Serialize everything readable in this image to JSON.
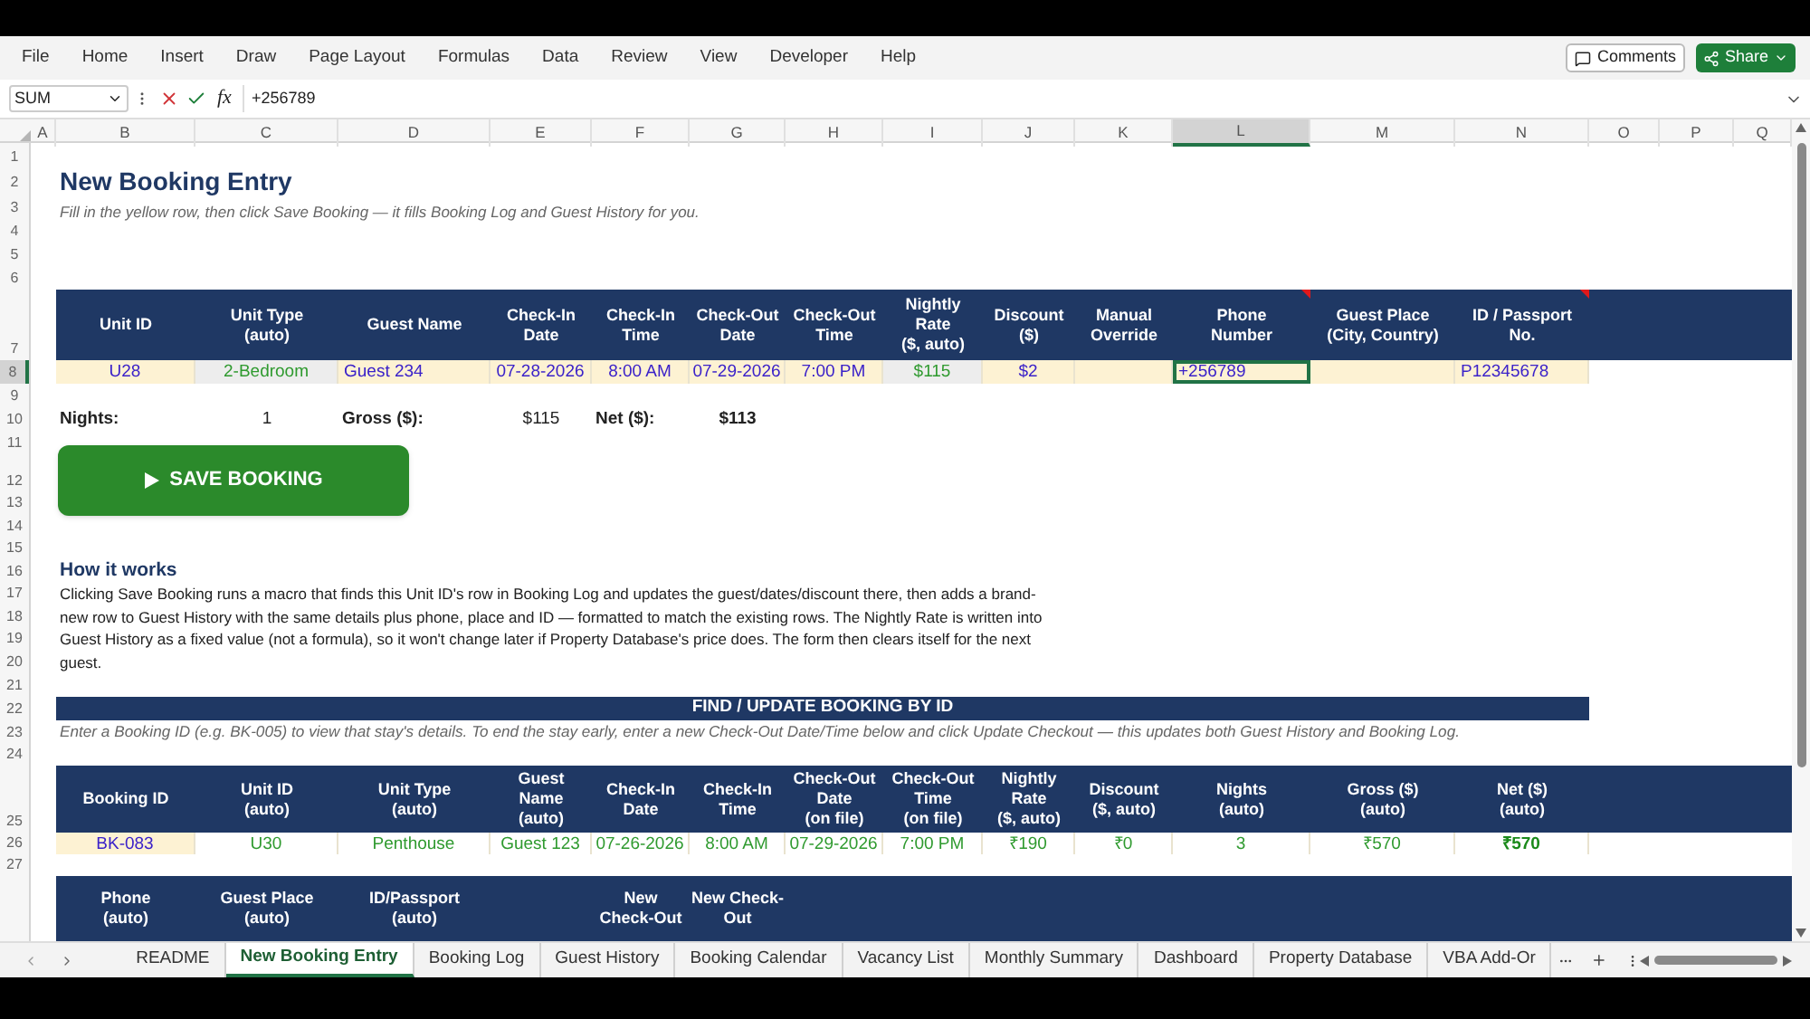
{
  "menu": [
    "File",
    "Home",
    "Insert",
    "Draw",
    "Page Layout",
    "Formulas",
    "Data",
    "Review",
    "View",
    "Developer",
    "Help"
  ],
  "title_bar_buttons": {
    "comments": "Comments",
    "share": "Share"
  },
  "formula_bar": {
    "name_box": "SUM",
    "fx": "fx",
    "value": "+256789"
  },
  "columns": [
    {
      "label": "A",
      "selected": false
    },
    {
      "label": "B",
      "selected": false
    },
    {
      "label": "C",
      "selected": false
    },
    {
      "label": "D",
      "selected": false
    },
    {
      "label": "E",
      "selected": false
    },
    {
      "label": "F",
      "selected": false
    },
    {
      "label": "G",
      "selected": false
    },
    {
      "label": "H",
      "selected": false
    },
    {
      "label": "I",
      "selected": false
    },
    {
      "label": "J",
      "selected": false
    },
    {
      "label": "K",
      "selected": false
    },
    {
      "label": "L",
      "selected": true
    },
    {
      "label": "M",
      "selected": false
    },
    {
      "label": "N",
      "selected": false
    },
    {
      "label": "O",
      "selected": false
    },
    {
      "label": "P",
      "selected": false
    },
    {
      "label": "Q",
      "selected": false
    }
  ],
  "rows": [
    {
      "label": "1",
      "selected": false
    },
    {
      "label": "2",
      "selected": false
    },
    {
      "label": "3",
      "selected": false
    },
    {
      "label": "4",
      "selected": false
    },
    {
      "label": "5",
      "selected": false
    },
    {
      "label": "6",
      "selected": false
    },
    {
      "label": "7",
      "selected": false
    },
    {
      "label": "8",
      "selected": true
    },
    {
      "label": "9",
      "selected": false
    },
    {
      "label": "10",
      "selected": false
    },
    {
      "label": "11",
      "selected": false
    },
    {
      "label": "12",
      "selected": false
    },
    {
      "label": "13",
      "selected": false
    },
    {
      "label": "14",
      "selected": false
    },
    {
      "label": "15",
      "selected": false
    },
    {
      "label": "16",
      "selected": false
    },
    {
      "label": "17",
      "selected": false
    },
    {
      "label": "18",
      "selected": false
    },
    {
      "label": "19",
      "selected": false
    },
    {
      "label": "20",
      "selected": false
    },
    {
      "label": "21",
      "selected": false
    },
    {
      "label": "22",
      "selected": false
    },
    {
      "label": "23",
      "selected": false
    },
    {
      "label": "24",
      "selected": false
    },
    {
      "label": "25",
      "selected": false
    },
    {
      "label": "26",
      "selected": false
    },
    {
      "label": "27",
      "selected": false
    }
  ],
  "sheet": {
    "title": "New Booking Entry",
    "subtitle": "Fill in the yellow row, then click Save Booking — it fills Booking Log and Guest History for you.",
    "entry_table": {
      "columns": [
        {
          "label": "Unit ID",
          "comment": false
        },
        {
          "label": "Unit Type\n(auto)",
          "comment": false
        },
        {
          "label": "Guest Name",
          "comment": false
        },
        {
          "label": "Check-In\nDate",
          "comment": false
        },
        {
          "label": "Check-In\nTime",
          "comment": false
        },
        {
          "label": "Check-Out\nDate",
          "comment": false
        },
        {
          "label": "Check-Out\nTime",
          "comment": false
        },
        {
          "label": "Nightly\nRate\n($, auto)",
          "comment": false
        },
        {
          "label": "Discount\n($)",
          "comment": false
        },
        {
          "label": "Manual\nOverride",
          "comment": false
        },
        {
          "label": "Phone\nNumber",
          "comment": true
        },
        {
          "label": "Guest Place\n(City, Country)",
          "comment": false
        },
        {
          "label": "ID / Passport\nNo.",
          "comment": true
        }
      ],
      "cells": [
        {
          "text": "U28",
          "kind": "input",
          "selected": false
        },
        {
          "text": "2-Bedroom",
          "kind": "auto",
          "selected": false
        },
        {
          "text": "Guest 234",
          "kind": "text",
          "selected": false
        },
        {
          "text": "07-28-2026",
          "kind": "input",
          "selected": false
        },
        {
          "text": "8:00 AM",
          "kind": "input",
          "selected": false
        },
        {
          "text": "07-29-2026",
          "kind": "input",
          "selected": false
        },
        {
          "text": "7:00 PM",
          "kind": "input",
          "selected": false
        },
        {
          "text": "$115",
          "kind": "auto",
          "selected": false
        },
        {
          "text": "$2",
          "kind": "input",
          "selected": false
        },
        {
          "kind": "input",
          "selected": false
        },
        {
          "text": "+256789",
          "kind": "text",
          "selected": true
        },
        {
          "kind": "input",
          "selected": false
        },
        {
          "text": "P12345678",
          "kind": "text",
          "selected": false
        }
      ]
    },
    "summary": [
      {
        "text": "Nights:",
        "kind": "label"
      },
      {
        "text": "1",
        "kind": "value"
      },
      {
        "text": "Gross ($):",
        "kind": "label"
      },
      {
        "text": "$115",
        "kind": "value"
      },
      {
        "text": "Net ($):",
        "kind": "label"
      },
      {
        "text": "$113",
        "kind": "total"
      }
    ],
    "save_button": {
      "label": "SAVE BOOKING"
    },
    "how_it_works": {
      "heading": "How it works",
      "text": "Clicking Save Booking runs a macro that finds this Unit ID's row in Booking Log and updates the guest/dates/discount there, then adds a brand-new row to Guest History with the same details plus phone, place and ID — formatted to match the existing rows. The Nightly Rate is written into Guest History as a fixed value (not a formula), so it won't change later if Property Database's price does. The form then clears itself for the next guest."
    },
    "find_banner": "FIND / UPDATE BOOKING BY ID",
    "find_note": "Enter a Booking ID (e.g. BK-005) to view that stay's details. To end the stay early, enter a new Check-Out Date/Time below and click Update Checkout — this updates both Guest History and Booking Log.",
    "lookup_table": {
      "columns": [
        {
          "label": "Booking ID"
        },
        {
          "label": "Unit ID\n(auto)"
        },
        {
          "label": "Unit Type\n(auto)"
        },
        {
          "label": "Guest\nName\n(auto)"
        },
        {
          "label": "Check-In\nDate"
        },
        {
          "label": "Check-In\nTime"
        },
        {
          "label": "Check-Out\nDate\n(on file)"
        },
        {
          "label": "Check-Out\nTime\n(on file)"
        },
        {
          "label": "Nightly\nRate\n($, auto)"
        },
        {
          "label": "Discount\n($, auto)"
        },
        {
          "label": "Nights\n(auto)"
        },
        {
          "label": "Gross ($)\n(auto)"
        },
        {
          "label": "Net ($)\n(auto)"
        }
      ],
      "cells": [
        {
          "text": "BK-083",
          "kind": "input"
        },
        {
          "text": "U30",
          "kind": "result"
        },
        {
          "text": "Penthouse",
          "kind": "result"
        },
        {
          "text": "Guest 123",
          "kind": "result"
        },
        {
          "text": "07-26-2026",
          "kind": "result"
        },
        {
          "text": "8:00 AM",
          "kind": "result"
        },
        {
          "text": "07-29-2026",
          "kind": "result"
        },
        {
          "text": "7:00 PM",
          "kind": "result"
        },
        {
          "text": "₹190",
          "kind": "result"
        },
        {
          "text": "₹0",
          "kind": "result"
        },
        {
          "text": "3",
          "kind": "result"
        },
        {
          "text": "₹570",
          "kind": "result"
        },
        {
          "text": "₹570",
          "kind": "total"
        }
      ]
    },
    "extra_table": {
      "columns": [
        {
          "label": "Phone\n(auto)"
        },
        {
          "label": "Guest Place\n(auto)"
        },
        {
          "label": "ID/Passport\n(auto)"
        },
        {},
        {
          "label": "New\nCheck-Out"
        },
        {
          "label": "New Check-\nOut"
        }
      ]
    }
  },
  "sheet_tabs": [
    {
      "label": "README",
      "selected": false
    },
    {
      "label": "New Booking Entry",
      "selected": true
    },
    {
      "label": "Booking Log",
      "selected": false
    },
    {
      "label": "Guest History",
      "selected": false
    },
    {
      "label": "Booking Calendar",
      "selected": false
    },
    {
      "label": "Vacancy List",
      "selected": false
    },
    {
      "label": "Monthly Summary",
      "selected": false
    },
    {
      "label": "Dashboard",
      "selected": false
    },
    {
      "label": "Property Database",
      "selected": false
    },
    {
      "label": "VBA Add-Or",
      "selected": false
    }
  ]
}
